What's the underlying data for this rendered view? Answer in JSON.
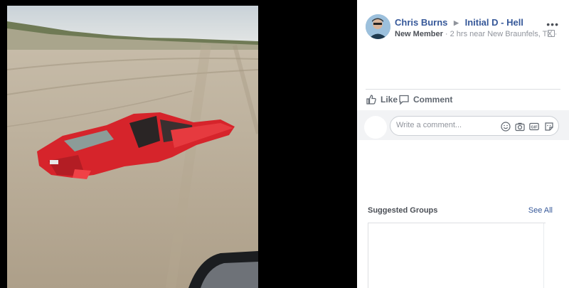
{
  "post": {
    "author": "Chris Burns",
    "group": "Initial D - Hell",
    "badge": "New Member",
    "meta": " · 2 hrs near New Braunfels, TX · "
  },
  "actions": {
    "like_label": "Like",
    "comment_label": "Comment"
  },
  "composer": {
    "placeholder": "Write a comment..."
  },
  "suggested": {
    "title": "Suggested Groups",
    "see_all": "See All"
  },
  "colors": {
    "link": "#365899",
    "muted": "#90949c",
    "car": "#e8262b"
  },
  "icons": [
    "like-icon",
    "comment-icon",
    "emoji-icon",
    "camera-icon",
    "gif-icon",
    "sticker-icon",
    "more-icon",
    "audience-icon"
  ]
}
